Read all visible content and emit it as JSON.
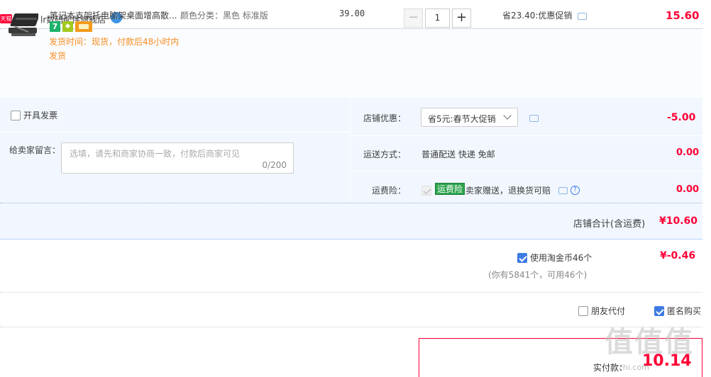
{
  "shop": {
    "badge": "天猫",
    "name": "店铺：lr数码配件旗舰店",
    "chat_badge": "1"
  },
  "item": {
    "title": "笔记本支架托电脑架桌面增高散...",
    "sku": "颜色分类：黑色 标准版",
    "service_icons": [
      "seven-day-return-icon",
      "warranty-icon",
      "card-payment-icon"
    ],
    "delivery": "发货时间：现货，付款后48小时内发货",
    "unit_price": "39.00",
    "qty_minus": "−",
    "qty_value": "1",
    "qty_plus": "+",
    "discount": "省23.40:优惠促销",
    "total": "15.60"
  },
  "options": {
    "invoice_label": "开具发票",
    "memo_label": "给卖家留言：",
    "memo_placeholder": "选填，请先和商家协商一致，付款后商家可见",
    "memo_count": "0/200",
    "shop_discount_label": "店铺优惠：",
    "shop_discount_value": "省5元:春节大促销",
    "shop_discount_amount": "-5.00",
    "shipping_label": "运送方式：",
    "shipping_value": "普通配送 快递 免邮",
    "shipping_amount": "0.00",
    "insurance_label": "运费险：",
    "insurance_tag": "运费险",
    "insurance_text": "卖家赠送，退换货可赔",
    "insurance_amount": "0.00"
  },
  "shop_total": {
    "label": "店铺合计(含运费)",
    "amount": "¥10.60"
  },
  "coins": {
    "label": "使用淘金币46个",
    "amount": "¥-0.46",
    "hint": "(你有5841个，可用46个)"
  },
  "friend_pay": "朋友代付",
  "anonymous": "匿名购买",
  "payment": {
    "label": "实付款：",
    "amount": "10.14"
  },
  "watermark": {
    "text": "值值值",
    "sub": "zhi.com"
  },
  "colors": {
    "price_red": "#ff0036",
    "panel_bg": "#f2f7ff",
    "accent_blue": "#3d7be3",
    "delivery_orange": "#f68c1e"
  }
}
